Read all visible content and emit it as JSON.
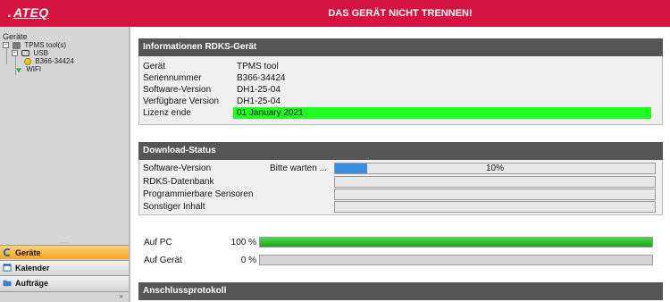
{
  "topbar": {
    "logo": "ATEQ",
    "title": "DAS GERÄT NICHT TRENNEN!"
  },
  "sidebar": {
    "tree_title": "Geräte",
    "tree": {
      "root": "TPMS tool(s)",
      "usb": "USB",
      "device": "B366-34424",
      "wifi": "WIFI"
    },
    "splitter": "......",
    "nav": {
      "devices": "Geräte",
      "calendar": "Kalender",
      "orders": "Aufträge"
    },
    "collapse": "»"
  },
  "info_panel": {
    "title": "Informationen RDKS-Gerät",
    "rows": [
      {
        "label": "Gerät",
        "value": "TPMS tool"
      },
      {
        "label": "Seriennummer",
        "value": "B366-34424"
      },
      {
        "label": "Software-Version",
        "value": "DH1-25-04"
      },
      {
        "label": "Verfügbare Version",
        "value": "DH1-25-04"
      },
      {
        "label": "Lizenz ende",
        "value": "01 January 2021"
      }
    ],
    "highlight_color": "#1eff1e"
  },
  "download_panel": {
    "title": "Download-Status",
    "rows": [
      {
        "label": "Software-Version",
        "status": "Bitte warten ...",
        "progress": 0.1,
        "pct_label": "10%"
      },
      {
        "label": "RDKS-Datenbank",
        "status": "",
        "progress": 0,
        "pct_label": ""
      },
      {
        "label": "Programmierbare Sensoren",
        "status": "",
        "progress": 0,
        "pct_label": ""
      },
      {
        "label": "Sonstiger Inhalt",
        "status": "",
        "progress": 0,
        "pct_label": ""
      }
    ],
    "bar_color": "#3b8fe0"
  },
  "transfer": {
    "pc": {
      "label": "Auf PC",
      "pct_label": "100 %",
      "progress": 1.0
    },
    "device": {
      "label": "Auf Gerät",
      "pct_label": "0 %",
      "progress": 0.0
    }
  },
  "protocol_panel": {
    "title": "Anschlussprotokoll"
  },
  "colors": {
    "brand_red": "#d4133f",
    "header_gray": "#555555",
    "active_nav": "#f5a623"
  }
}
